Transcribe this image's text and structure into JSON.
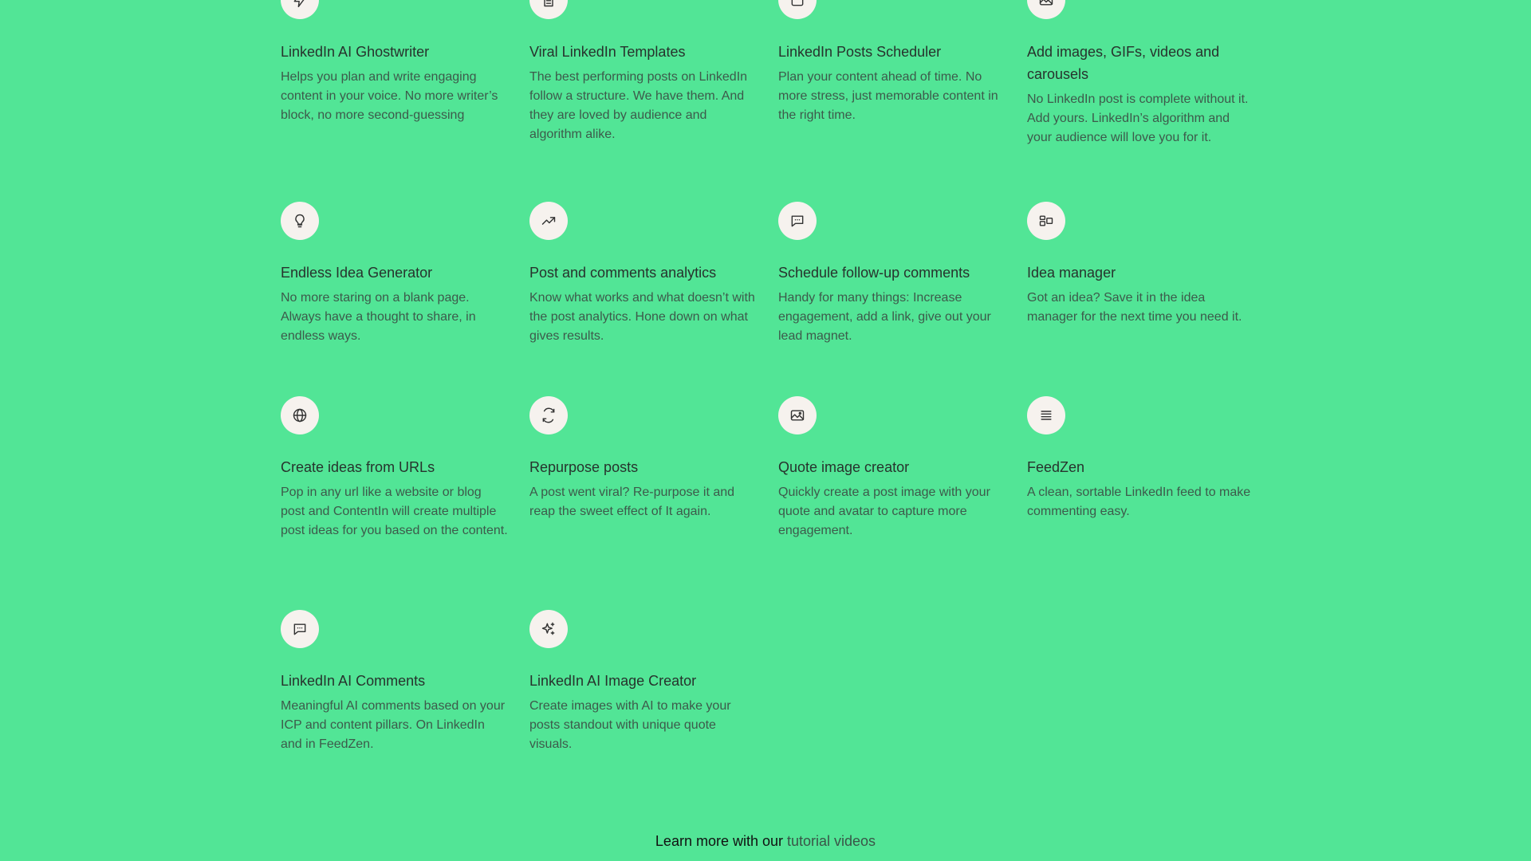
{
  "features": [
    {
      "title": "LinkedIn AI Ghostwriter",
      "desc": "Helps you plan and write engaging content in your voice. No more writer’s block, no more second-guessing",
      "icon": "lightning-icon"
    },
    {
      "title": "Viral LinkedIn Templates",
      "desc": "The best performing posts on LinkedIn follow a structure. We have them. And they are loved by audience and algorithm alike.",
      "icon": "document-icon"
    },
    {
      "title": "LinkedIn Posts Scheduler",
      "desc": "Plan your content ahead of time. No more stress, just memorable content in the right time.",
      "icon": "calendar-icon"
    },
    {
      "title": "Add images, GIFs, videos and carousels",
      "desc": "No LinkedIn post is complete without it. Add yours. LinkedIn’s algorithm and your audience will love you for it.",
      "icon": "image-icon"
    },
    {
      "title": "Endless Idea Generator",
      "desc": "No more staring on a blank page. Always have a thought to share, in endless ways.",
      "icon": "lightbulb-icon"
    },
    {
      "title": "Post and comments analytics",
      "desc": "Know what works and what doesn’t with the post analytics. Hone down on what gives results.",
      "icon": "trending-up-icon"
    },
    {
      "title": "Schedule follow-up comments",
      "desc": "Handy for many things: Increase engagement, add a link, give out your lead magnet.",
      "icon": "comment-icon"
    },
    {
      "title": "Idea manager",
      "desc": "Got an idea? Save it in the idea manager for the next time you need it.",
      "icon": "layout-icon"
    },
    {
      "title": "Create ideas from URLs",
      "desc": "Pop in any url like a website or blog post and ContentIn will create multiple post ideas for you based on the content.",
      "icon": "globe-icon"
    },
    {
      "title": "Repurpose posts",
      "desc": "A post went viral? Re-purpose it and reap the sweet effect of It again.",
      "icon": "refresh-icon"
    },
    {
      "title": "Quote image creator",
      "desc": "Quickly create a post image with your quote and avatar to capture more engagement.",
      "icon": "image-icon"
    },
    {
      "title": "FeedZen",
      "desc": "A clean, sortable LinkedIn feed to make commenting easy.",
      "icon": "list-icon"
    },
    {
      "title": "LinkedIn AI Comments",
      "desc": "Meaningful AI comments based on your ICP and content pillars. On LinkedIn and in FeedZen.",
      "icon": "comment-icon"
    },
    {
      "title": "LinkedIn AI Image Creator",
      "desc": "Create images with AI to make your posts standout with unique quote visuals.",
      "icon": "sparkles-icon"
    }
  ],
  "footer": {
    "prefix": "Learn more with our ",
    "link": "tutorial videos"
  },
  "colors": {
    "background": "#52e596",
    "icon_bg": "#f6f2ee"
  }
}
